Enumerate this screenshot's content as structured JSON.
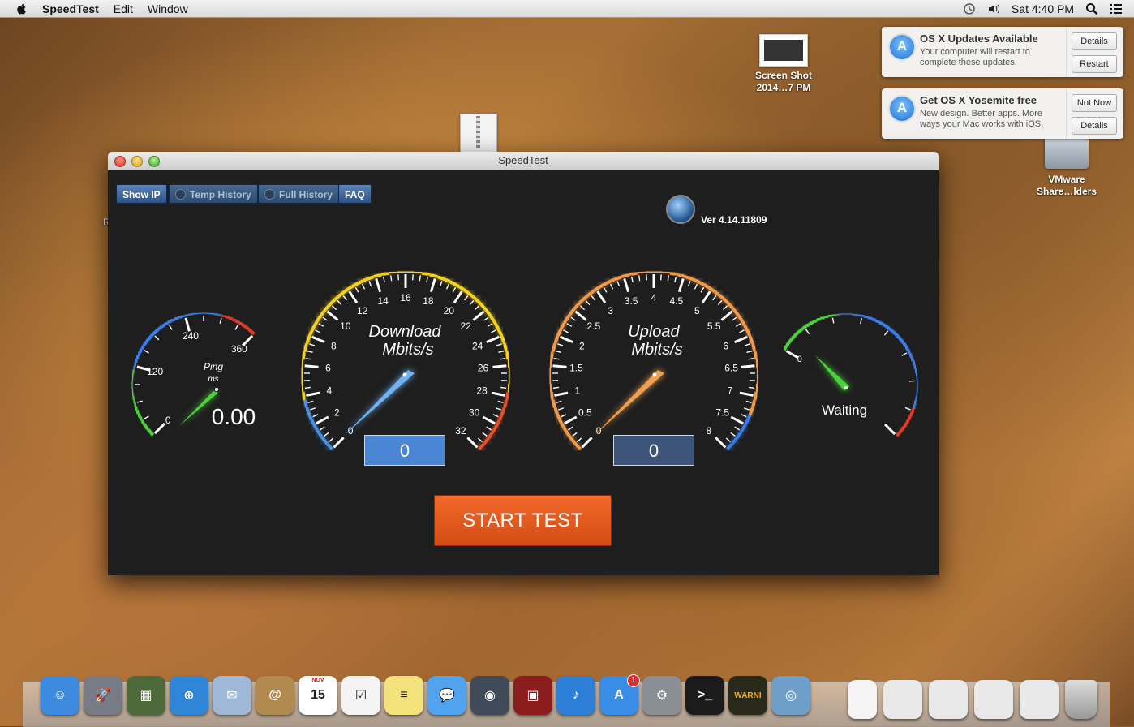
{
  "menubar": {
    "app_name": "SpeedTest",
    "menus": [
      "Edit",
      "Window"
    ],
    "clock": "Sat 4:40 PM",
    "icons": [
      "apple-icon",
      "time-machine-icon",
      "volume-icon",
      "spotlight-icon",
      "notification-center-icon"
    ]
  },
  "desktop": {
    "icons": [
      {
        "name": "screenshot",
        "label_line1": "Screen Shot",
        "label_line2": "2014…7 PM"
      },
      {
        "name": "vmware-shared",
        "label_line1": "VMware",
        "label_line2": "Share…lders"
      }
    ],
    "stray_text": "R"
  },
  "notifications": [
    {
      "title": "OS X Updates Available",
      "body": "Your computer will restart to complete these updates.",
      "buttons": [
        "Details",
        "Restart"
      ]
    },
    {
      "title": "Get OS X Yosemite free",
      "body": "New design. Better apps. More ways your Mac works with iOS.",
      "buttons": [
        "Not Now",
        "Details"
      ]
    }
  ],
  "window": {
    "title": "SpeedTest",
    "tabs": [
      "Show IP",
      "Temp History",
      "Full History",
      "FAQ"
    ],
    "version": "Ver 4.14.11809",
    "start_button": "START TEST",
    "ping": {
      "label_line1": "Ping",
      "label_line2": "ms",
      "value": "0.00",
      "ticks": [
        "0",
        "120",
        "240",
        "360"
      ],
      "reading": 0
    },
    "download": {
      "label_line1": "Download",
      "label_line2": "Mbits/s",
      "value": "0",
      "ticks": [
        "0",
        "2",
        "4",
        "6",
        "8",
        "10",
        "12",
        "14",
        "16",
        "18",
        "20",
        "22",
        "24",
        "26",
        "28",
        "30",
        "32"
      ],
      "reading": 0
    },
    "upload": {
      "label_line1": "Upload",
      "label_line2": "Mbits/s",
      "value": "0",
      "ticks": [
        "0",
        "0.5",
        "1",
        "1.5",
        "2",
        "2.5",
        "3",
        "3.5",
        "4",
        "4.5",
        "5",
        "5.5",
        "6",
        "6.5",
        "7",
        "7.5",
        "8"
      ],
      "reading": 0
    },
    "status": {
      "label": "Waiting",
      "ticks": [
        "0"
      ]
    },
    "colors": {
      "download_box": "#4a86d4",
      "upload_box": "#3c5578",
      "start_button": "#e65a1c",
      "accent": "#2c5288"
    }
  },
  "dock": {
    "apps": [
      {
        "name": "finder",
        "color": "#3d8be0",
        "glyph": "☺"
      },
      {
        "name": "launchpad",
        "color": "#777b85",
        "glyph": "🚀"
      },
      {
        "name": "mission-control",
        "color": "#4f6a3a",
        "glyph": "▦"
      },
      {
        "name": "safari",
        "color": "#2f86d9",
        "glyph": "⊕"
      },
      {
        "name": "mail",
        "color": "#9fb8d8",
        "glyph": "✉"
      },
      {
        "name": "contacts",
        "color": "#b08a4e",
        "glyph": "@"
      },
      {
        "name": "calendar",
        "color": "#ffffff",
        "glyph": "15",
        "month": "NOV"
      },
      {
        "name": "reminders",
        "color": "#f4f4f4",
        "glyph": "☑"
      },
      {
        "name": "notes",
        "color": "#f3e27a",
        "glyph": "≡"
      },
      {
        "name": "messages",
        "color": "#4fa3ef",
        "glyph": "💬"
      },
      {
        "name": "facetime",
        "color": "#404a58",
        "glyph": "◉"
      },
      {
        "name": "photo-booth",
        "color": "#8b1d1d",
        "glyph": "▣"
      },
      {
        "name": "itunes",
        "color": "#2d7fd8",
        "glyph": "♪"
      },
      {
        "name": "app-store",
        "color": "#3a8de6",
        "glyph": "A",
        "badge": "1"
      },
      {
        "name": "system-preferences",
        "color": "#8a8f96",
        "glyph": "⚙"
      },
      {
        "name": "terminal",
        "color": "#1b1b1b",
        "glyph": ">_"
      },
      {
        "name": "console",
        "color": "#2a2a1a",
        "glyph": "WARNI"
      },
      {
        "name": "speedtest",
        "color": "#6f9ec9",
        "glyph": "◎"
      }
    ],
    "right_items": [
      "document",
      "downloads-stack",
      "documents-stack",
      "applications-stack",
      "desktop-stack",
      "trash"
    ]
  }
}
